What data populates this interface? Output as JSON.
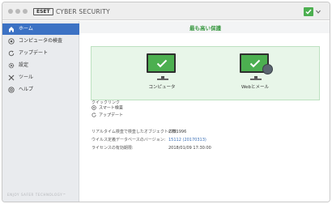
{
  "window": {
    "logo_text": "ESET",
    "title": "CYBER SECURITY"
  },
  "sidebar": {
    "items": [
      {
        "label": "ホーム",
        "icon": "home-icon"
      },
      {
        "label": "コンピュータの検査",
        "icon": "scan-icon"
      },
      {
        "label": "アップデート",
        "icon": "update-icon"
      },
      {
        "label": "設定",
        "icon": "gear-icon"
      },
      {
        "label": "ツール",
        "icon": "tools-icon"
      },
      {
        "label": "ヘルプ",
        "icon": "help-icon"
      }
    ],
    "footer": "ENJOY SAFER TECHNOLOGY™"
  },
  "main": {
    "heading": "最も高い保護",
    "status": {
      "computer_label": "コンピュータ",
      "web_label": "Webとメール",
      "color": "#4caf50"
    },
    "quick_links": {
      "title": "クイックリンク",
      "items": [
        "スマート検査",
        "アップデート"
      ]
    },
    "info": [
      {
        "label": "リアルタイム検査で検査したオブジェクトの数:",
        "value": "2701996"
      },
      {
        "label": "ウイルス定義データベースのバージョン:",
        "value": "15112 (20170313)"
      },
      {
        "label": "ライセンスの有効期限:",
        "value": "2018/01/09 17:30:00"
      }
    ]
  }
}
